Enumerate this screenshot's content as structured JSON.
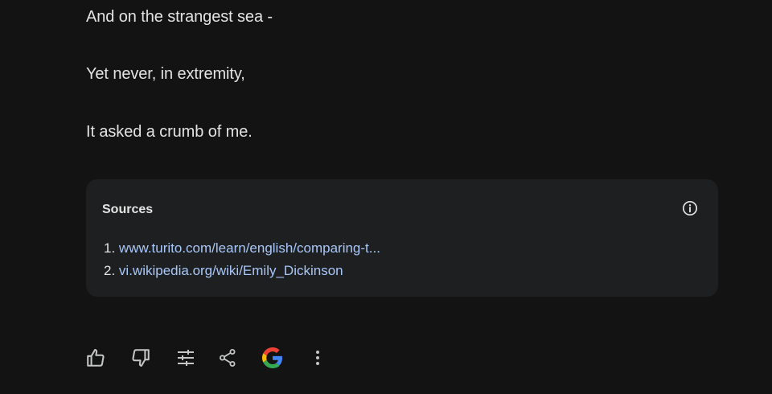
{
  "poem": {
    "lines": [
      "And on the strangest sea -",
      "Yet never, in extremity,",
      "It asked a crumb of me."
    ]
  },
  "sources": {
    "title": "Sources",
    "items": [
      {
        "number": "1.",
        "text": "www.turito.com/learn/english/comparing-t..."
      },
      {
        "number": "2.",
        "text": "vi.wikipedia.org/wiki/Emily_Dickinson"
      }
    ],
    "info_icon": "info-circle-icon"
  },
  "actions": [
    {
      "icon": "thumbs-up-icon"
    },
    {
      "icon": "thumbs-down-icon"
    },
    {
      "icon": "tune-icon"
    },
    {
      "icon": "share-icon"
    },
    {
      "icon": "google-icon"
    },
    {
      "icon": "more-vertical-icon"
    }
  ],
  "colors": {
    "background": "#131314",
    "card": "#1e1f20",
    "text": "#e3e3e3",
    "link": "#a8c7fa",
    "icon": "#c4c7c5"
  }
}
